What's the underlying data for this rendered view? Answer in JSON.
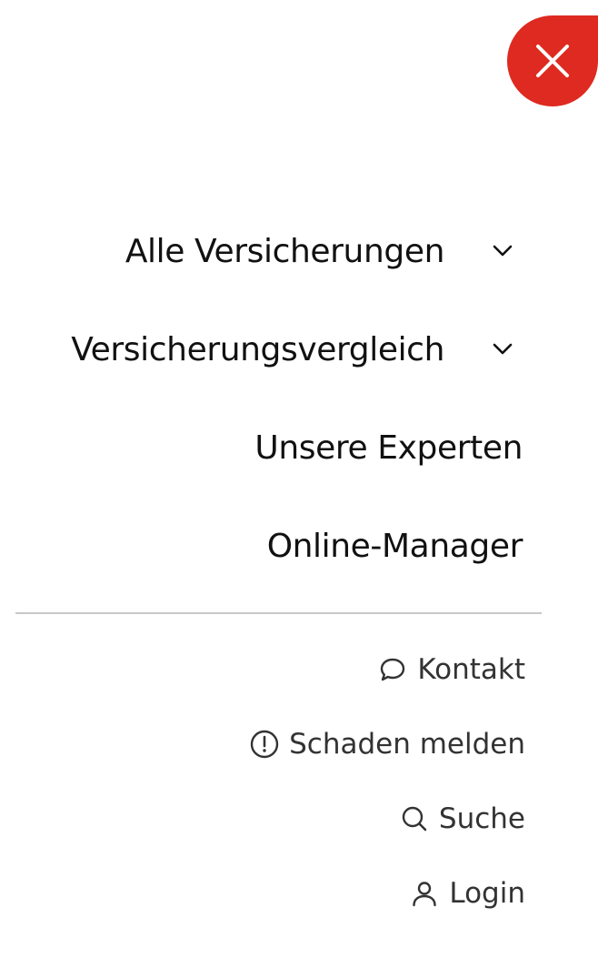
{
  "close_button": {
    "label": "",
    "color": "#de2a20",
    "icon": "close-icon"
  },
  "main_nav": {
    "items": [
      {
        "label": "Alle Versicherungen",
        "has_dropdown": true,
        "icon": "chevron-down-icon"
      },
      {
        "label": "Versicherungsvergleich",
        "has_dropdown": true,
        "icon": "chevron-down-icon"
      },
      {
        "label": "Unsere Experten",
        "has_dropdown": false
      },
      {
        "label": "Online-Manager",
        "has_dropdown": false
      }
    ]
  },
  "service_nav": {
    "items": [
      {
        "label": "Kontakt",
        "icon": "chat-bubble-icon"
      },
      {
        "label": "Schaden melden",
        "icon": "exclamation-circle-icon"
      },
      {
        "label": "Suche",
        "icon": "search-icon"
      },
      {
        "label": "Login",
        "icon": "user-icon"
      }
    ]
  },
  "colors": {
    "accent": "#de2a20",
    "text": "#111111",
    "secondary_text": "#333333",
    "divider": "#c8c8c8"
  }
}
